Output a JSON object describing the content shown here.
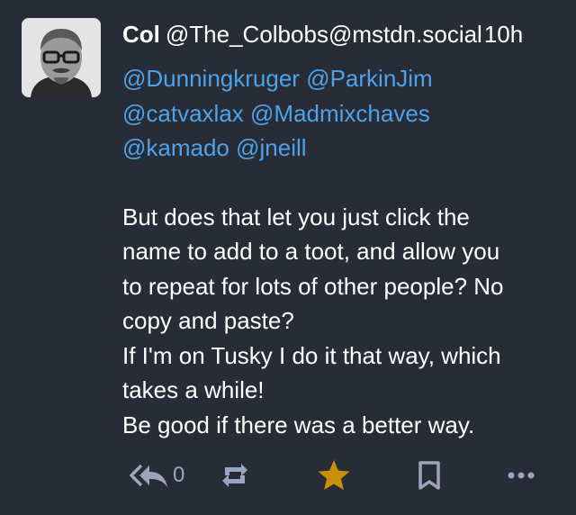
{
  "status": {
    "display_name": "Col",
    "acct": "@The_Colbobs@mstdn.social",
    "time": "10h",
    "mentions": [
      [
        "@Dunningkruger",
        "@ParkinJim"
      ],
      [
        "@catvaxlax",
        "@Madmixchaves"
      ],
      [
        "@kamado",
        "@jneill"
      ]
    ],
    "body_lines": [
      "But does that let you just click the",
      "name to add to a toot, and allow you",
      "to repeat for lots of other people? No",
      "copy and paste?",
      "If I'm on Tusky I do it that way, which",
      "takes a while!",
      "Be good if there was a better way."
    ]
  },
  "actions": {
    "reply_icon": "reply-all-icon",
    "reply_count": "0",
    "boost_icon": "boost-icon",
    "favourite_icon": "star-icon",
    "favourited": true,
    "bookmark_icon": "bookmark-icon",
    "more_icon": "more-icon"
  },
  "colors": {
    "background": "#282c37",
    "mention": "#4ea2e8",
    "icon": "#9aa5c0",
    "favourite": "#ca8f04"
  }
}
